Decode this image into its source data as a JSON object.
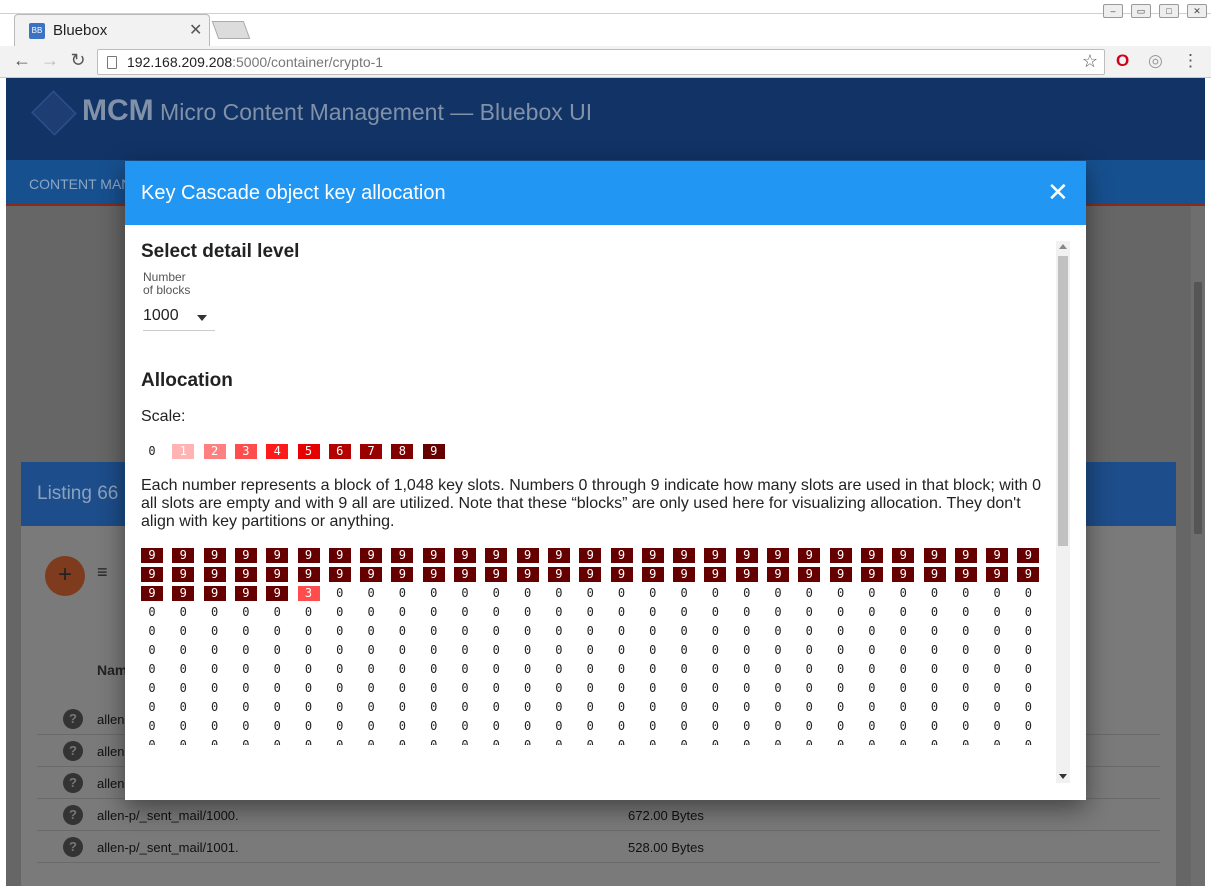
{
  "browser": {
    "tab_title": "Bluebox",
    "tab_favicon_text": "BB",
    "url_host": "192.168.209.208",
    "url_rest": ":5000/container/crypto-1"
  },
  "app": {
    "brand_short": "MCM",
    "brand_long": "Micro Content Management — Bluebox UI",
    "nav_item": "CONTENT MAN",
    "listing_title": "Listing 66",
    "fab_label": "+",
    "column_name": "Nam",
    "rows": [
      {
        "name": "allen",
        "size": ""
      },
      {
        "name": "allen",
        "size": ""
      },
      {
        "name": "allen",
        "size": ""
      },
      {
        "name": "allen-p/_sent_mail/1000.",
        "size": "672.00 Bytes"
      },
      {
        "name": "allen-p/_sent_mail/1001.",
        "size": "528.00 Bytes"
      }
    ]
  },
  "modal": {
    "title": "Key Cascade object key allocation",
    "close_label": "✕",
    "detail_heading": "Select detail level",
    "select_label_line1": "Number",
    "select_label_line2": "of blocks",
    "select_value": "1000",
    "allocation_heading": "Allocation",
    "scale_label": "Scale:",
    "scale": [
      0,
      1,
      2,
      3,
      4,
      5,
      6,
      7,
      8,
      9
    ],
    "scale_colors": [
      "#ffffff",
      "#ffb3b3",
      "#ff8080",
      "#ff4d4d",
      "#ff1a1a",
      "#e60000",
      "#b30000",
      "#990000",
      "#800000",
      "#660000"
    ],
    "description": "Each number represents a block of 1,048 key slots. Numbers 0 through 9 indicate how many slots are used in that block; with 0 all slots are empty and with 9 all are utilized. Note that these “blocks” are only used here for visualizing allocation. They don't align with key partitions or anything.",
    "grid_columns": 29,
    "grid_visible_rows": 11,
    "full_blocks": 63,
    "partial_block_value": 3
  }
}
